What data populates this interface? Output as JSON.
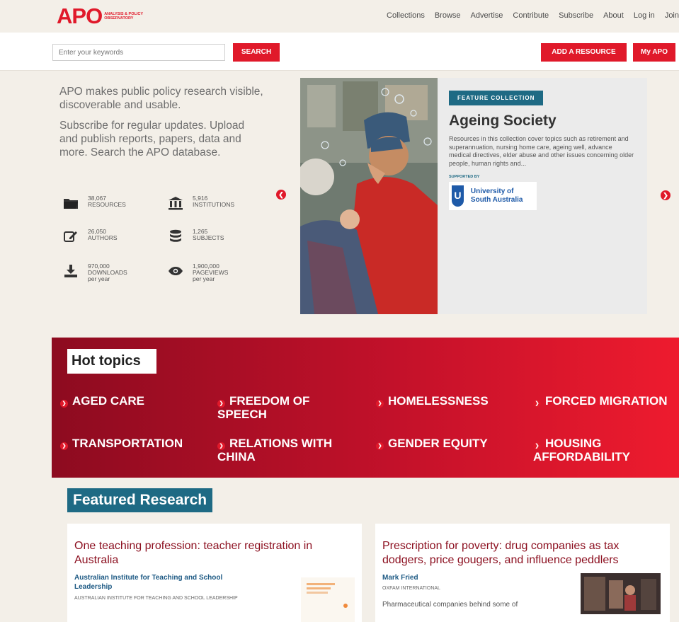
{
  "header": {
    "logo": "APO",
    "logo_tagline": "ANALYSIS & POLICY OBSERVATORY",
    "nav": [
      "Collections",
      "Browse",
      "Advertise",
      "Contribute",
      "Subscribe",
      "About",
      "Log in",
      "Join"
    ]
  },
  "search": {
    "placeholder": "Enter your keywords",
    "button": "SEARCH",
    "add_resource": "ADD A RESOURCE",
    "my_apo": "My APO"
  },
  "intro": {
    "tagline": "APO makes public policy research visible, discoverable and usable.",
    "subscribe": "Subscribe for regular updates. Upload and publish reports, papers, data and more. Search the APO database."
  },
  "stats": [
    {
      "number": "38,067",
      "label": "RESOURCES",
      "sub": "",
      "icon": "folder-icon"
    },
    {
      "number": "5,916",
      "label": "INSTITUTIONS",
      "sub": "",
      "icon": "institution-icon"
    },
    {
      "number": "26,050",
      "label": "AUTHORS",
      "sub": "",
      "icon": "edit-icon"
    },
    {
      "number": "1,265",
      "label": "SUBJECTS",
      "sub": "",
      "icon": "database-icon"
    },
    {
      "number": "970,000",
      "label": "DOWNLOADS",
      "sub": "per year",
      "icon": "download-icon"
    },
    {
      "number": "1,900,000",
      "label": "PAGEVIEWS",
      "sub": "per year",
      "icon": "eye-icon"
    }
  ],
  "feature": {
    "badge": "FEATURE COLLECTION",
    "title": "Ageing Society",
    "description": "Resources in this collection cover topics such as retirement and superannuation, nursing home care, ageing well, advance medical directives, elder abuse and other issues concerning older people, human rights and...",
    "supported_by": "SUPPORTED BY",
    "sponsor": "University of South Australia"
  },
  "hot_topics": {
    "title": "Hot topics",
    "items": [
      "AGED CARE",
      "FREEDOM OF SPEECH",
      "HOMELESSNESS",
      "FORCED MIGRATION",
      "TRANSPORTATION",
      "RELATIONS WITH CHINA",
      "GENDER EQUITY",
      "HOUSING AFFORDABILITY"
    ]
  },
  "featured_research": {
    "title": "Featured Research",
    "cards": [
      {
        "title": "One teaching profession: teacher registration in Australia",
        "author": "Australian Institute for Teaching and School Leadership",
        "org": "AUSTRALIAN INSTITUTE FOR TEACHING AND SCHOOL LEADERSHIP",
        "snippet": ""
      },
      {
        "title": "Prescription for poverty: drug companies as tax dodgers, price gougers, and influence peddlers",
        "author": "Mark Fried",
        "org": "OXFAM INTERNATIONAL",
        "snippet": "Pharmaceutical companies behind some of"
      }
    ]
  },
  "colors": {
    "brand_red": "#e0192a",
    "teal": "#1e6a84",
    "dark_red": "#8d0b20"
  }
}
